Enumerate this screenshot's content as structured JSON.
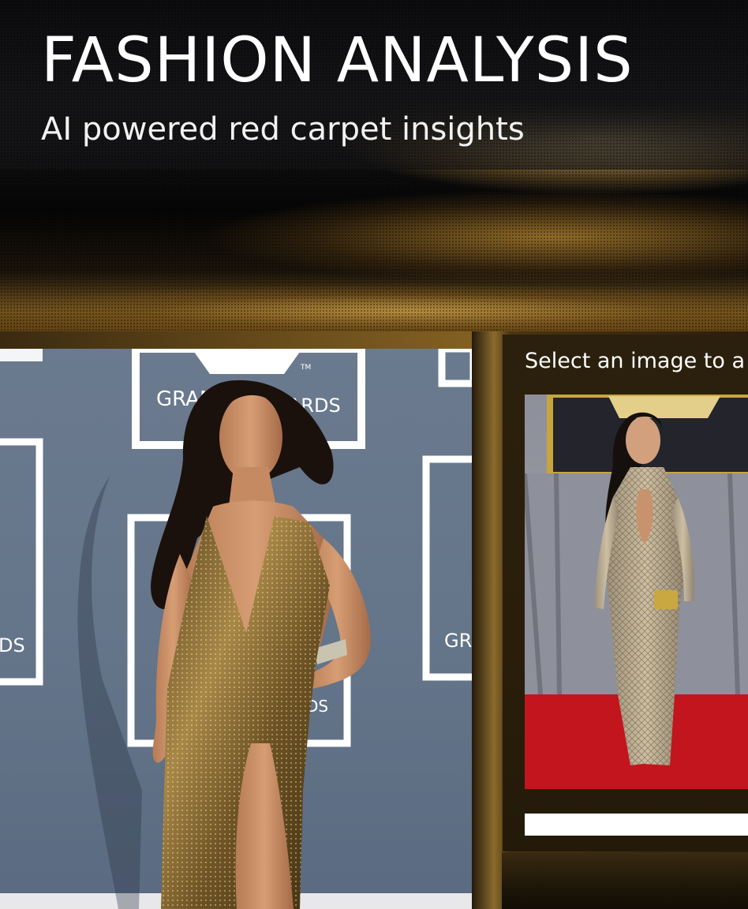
{
  "header": {
    "title": "FASHION ANALYSIS",
    "subtitle": "AI powered red carpet insights"
  },
  "main_image": {
    "alt": "Red carpet photo: gold sequined halter gown",
    "backdrop_text": [
      "GRAM",
      "VARDS",
      "DS",
      "GR",
      "DS"
    ],
    "trademark": "TM"
  },
  "side_panel": {
    "select_prompt": "Select an image to a",
    "thumbnails": [
      {
        "alt": "Red carpet photo: sheer embellished gown with keyhole neckline"
      }
    ],
    "progress": 1.0
  },
  "colors": {
    "background": "#0a0806",
    "gold_accent": "#8a6b2c",
    "panel": "#2b200d",
    "text": "#ffffff",
    "carpet_red": "#c3151e"
  }
}
